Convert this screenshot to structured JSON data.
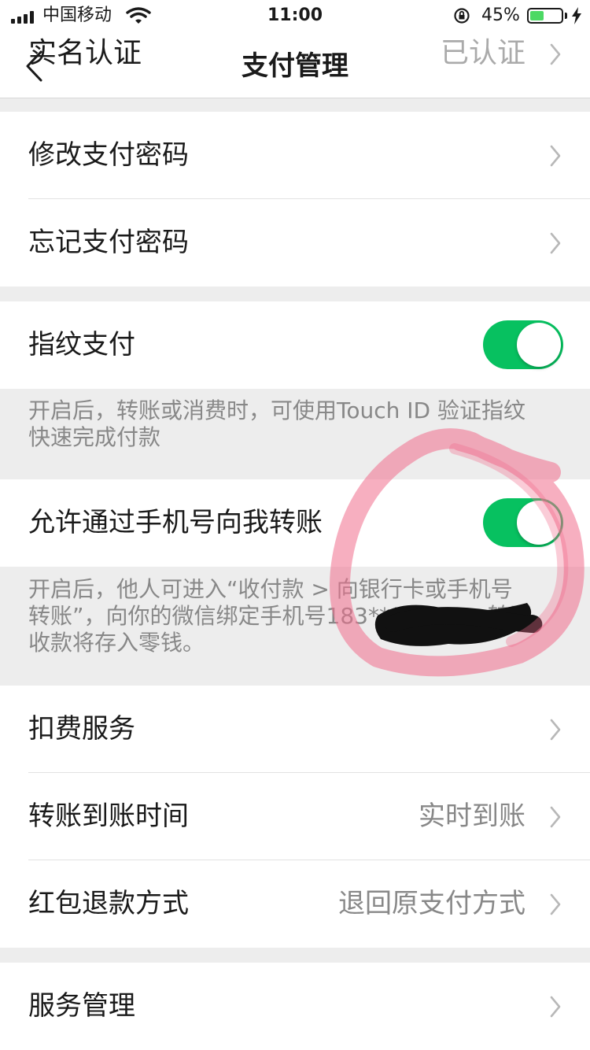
{
  "status_bar": {
    "carrier": "中国移动",
    "time": "11:00",
    "battery": "45%",
    "battery_level": 0.45,
    "battery_color": "#4cd964"
  },
  "nav": {
    "title": "支付管理",
    "back_icon": "chevron-left-icon",
    "behind_left": "实名认证",
    "behind_right": "已认证"
  },
  "groups": {
    "password": {
      "change": {
        "label": "修改支付密码"
      },
      "forgot": {
        "label": "忘记支付密码"
      }
    },
    "fingerprint": {
      "label": "指纹支付",
      "enabled": true,
      "note_line1": "开启后，转账或消费时，可使用Touch ID 验证指纹",
      "note_line2": "快速完成付款"
    },
    "phone_transfer": {
      "label": "允许通过手机号向我转账",
      "enabled": true,
      "note_line1": "开启后，他人可进入“收付款 > 向银行卡或手机号",
      "note_line2": "转账”，向你的微信绑定手机号183****",
      "note_line2_tail": "转账，",
      "note_line3": "收款将存入零钱。"
    },
    "services": {
      "deduction": {
        "label": "扣费服务"
      },
      "arrival": {
        "label": "转账到账时间",
        "value": "实时到账"
      },
      "refund": {
        "label": "红包退款方式",
        "value": "退回原支付方式"
      }
    },
    "manage": {
      "label": "服务管理"
    }
  },
  "colors": {
    "accent_green": "#07c160",
    "annotation_pink": "#f06e8c"
  }
}
